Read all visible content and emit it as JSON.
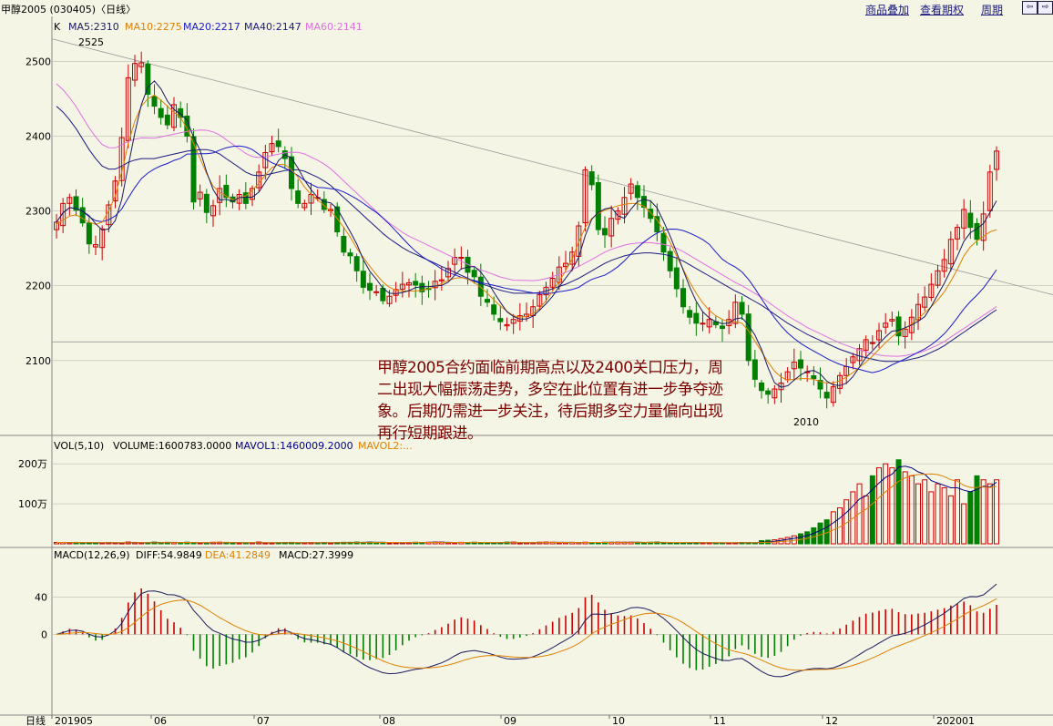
{
  "header": {
    "title": "甲醇2005 (030405)〈日线〉",
    "links": [
      "商品叠加",
      "查看期权",
      "周期"
    ],
    "nav_prev": "⇦",
    "nav_next": "⇨"
  },
  "colors": {
    "bg": "#f5f5e6",
    "grid": "#bdbdb0",
    "up": "#cc0000",
    "down": "#008000",
    "ma5": "#1a1a60",
    "ma10": "#e08000",
    "ma20": "#1a1acc",
    "ma40": "#1a1a80",
    "ma60": "#e070e0",
    "annotation": "#7a0000"
  },
  "chart_data": [
    {
      "type": "candlestick",
      "panel": "price",
      "legend": {
        "k": "K",
        "ma5": "MA5:2310",
        "ma10": "MA10:2275",
        "ma20": "MA20:2217",
        "ma40": "MA40:2147",
        "ma60": "MA60:2141"
      },
      "y_ticks": [
        "2500",
        "2400",
        "2300",
        "2200",
        "2100"
      ],
      "ylim": [
        2000,
        2560
      ],
      "annotations": {
        "high_label": "2525",
        "low_label": "2010"
      },
      "close_series": [
        2285,
        2310,
        2318,
        2301,
        2284,
        2256,
        2255,
        2276,
        2308,
        2340,
        2398,
        2478,
        2497,
        2498,
        2456,
        2440,
        2425,
        2415,
        2442,
        2425,
        2400,
        2312,
        2325,
        2298,
        2307,
        2330,
        2318,
        2312,
        2322,
        2310,
        2330,
        2352,
        2378,
        2390,
        2386,
        2370,
        2330,
        2310,
        2310,
        2322,
        2318,
        2302,
        2302,
        2272,
        2245,
        2240,
        2220,
        2198,
        2194,
        2192,
        2180,
        2186,
        2195,
        2202,
        2204,
        2201,
        2192,
        2195,
        2206,
        2208,
        2223,
        2238,
        2238,
        2218,
        2212,
        2186,
        2178,
        2162,
        2152,
        2148,
        2155,
        2160,
        2162,
        2172,
        2188,
        2198,
        2210,
        2225,
        2230,
        2245,
        2280,
        2355,
        2335,
        2275,
        2268,
        2290,
        2300,
        2318,
        2336,
        2318,
        2305,
        2290,
        2272,
        2245,
        2220,
        2196,
        2172,
        2158,
        2150,
        2150,
        2155,
        2148,
        2143,
        2155,
        2178,
        2162,
        2100,
        2075,
        2060,
        2055,
        2062,
        2070,
        2085,
        2098,
        2090,
        2085,
        2076,
        2062,
        2050,
        2065,
        2080,
        2092,
        2105,
        2116,
        2128,
        2124,
        2140,
        2150,
        2155,
        2133,
        2142,
        2158,
        2175,
        2185,
        2202,
        2220,
        2235,
        2262,
        2278,
        2302,
        2278,
        2262,
        2296,
        2352,
        2380
      ],
      "ma10_series": [
        2282,
        2288,
        2293,
        2295,
        2290,
        2285,
        2282,
        2285,
        2300,
        2320,
        2352,
        2390,
        2420,
        2440,
        2450,
        2455,
        2448,
        2440,
        2432,
        2425,
        2410,
        2390,
        2370,
        2350,
        2333,
        2325,
        2320,
        2315,
        2317,
        2320,
        2328,
        2337,
        2348,
        2358,
        2362,
        2362,
        2355,
        2345,
        2332,
        2322,
        2315,
        2307,
        2300,
        2290,
        2278,
        2265,
        2250,
        2238,
        2226,
        2215,
        2205,
        2198,
        2194,
        2193,
        2193,
        2193,
        2194,
        2196,
        2199,
        2203,
        2207,
        2210,
        2211,
        2209,
        2204,
        2198,
        2190,
        2181,
        2173,
        2166,
        2160,
        2158,
        2159,
        2163,
        2170,
        2180,
        2193,
        2206,
        2220,
        2236,
        2258,
        2278,
        2290,
        2297,
        2301,
        2304,
        2307,
        2309,
        2310,
        2310,
        2306,
        2298,
        2288,
        2274,
        2258,
        2240,
        2222,
        2205,
        2190,
        2177,
        2167,
        2160,
        2155,
        2152,
        2152,
        2150,
        2140,
        2126,
        2112,
        2098,
        2086,
        2078,
        2074,
        2075,
        2076,
        2076,
        2075,
        2072,
        2070,
        2070,
        2073,
        2078,
        2084,
        2091,
        2098,
        2106,
        2115,
        2124,
        2132,
        2138,
        2143,
        2149,
        2156,
        2164,
        2172,
        2181,
        2192,
        2206,
        2222,
        2240,
        2252,
        2260,
        2266,
        2272,
        2275
      ],
      "ma40_series": [
        2440,
        2432,
        2422,
        2410,
        2396,
        2382,
        2370,
        2360,
        2356,
        2356,
        2360,
        2365,
        2368,
        2370,
        2370,
        2370,
        2372,
        2374,
        2376,
        2378,
        2380,
        2381,
        2382,
        2382,
        2380,
        2376,
        2370,
        2364,
        2358,
        2352,
        2348,
        2347,
        2348,
        2350,
        2352,
        2354,
        2355,
        2355,
        2353,
        2349,
        2345,
        2340,
        2334,
        2326,
        2318,
        2310,
        2302,
        2294,
        2286,
        2278,
        2270,
        2263,
        2257,
        2251,
        2246,
        2242,
        2238,
        2234,
        2230,
        2226,
        2222,
        2218,
        2214,
        2210,
        2206,
        2203,
        2200,
        2197,
        2194,
        2192,
        2190,
        2190,
        2190,
        2190,
        2191,
        2193,
        2196,
        2199,
        2202,
        2206,
        2210,
        2215,
        2220,
        2225,
        2230,
        2234,
        2237,
        2240,
        2242,
        2243,
        2244,
        2244,
        2243,
        2242,
        2240,
        2237,
        2233,
        2228,
        2223,
        2218,
        2213,
        2208,
        2203,
        2198,
        2193,
        2189,
        2184,
        2179,
        2174,
        2168,
        2162,
        2156,
        2150,
        2145,
        2140,
        2135,
        2131,
        2127,
        2123,
        2119,
        2115,
        2112,
        2109,
        2106,
        2104,
        2102,
        2100,
        2099,
        2099,
        2099,
        2100,
        2102,
        2104,
        2107,
        2111,
        2115,
        2120,
        2126,
        2132,
        2138,
        2144,
        2150,
        2156,
        2162,
        2168
      ]
    },
    {
      "type": "bar",
      "panel": "volume",
      "legend": {
        "vol": "VOL(5,10)",
        "volume": "VOLUME:1600783.0000",
        "mavol1": "MAVOL1:1460009.2000",
        "mavol2": "MAVOL2:..."
      },
      "y_ticks": [
        "200万",
        "100万"
      ],
      "ylim": [
        0,
        2300000
      ],
      "late_values": [
        80000,
        90000,
        100000,
        130000,
        160000,
        200000,
        250000,
        300000,
        400000,
        520000,
        600000,
        800000,
        900000,
        1100000,
        1300000,
        1500000,
        1200000,
        1700000,
        1900000,
        2000000,
        1900000,
        2100000,
        1800000,
        1700000,
        1500000,
        1600000,
        1300000,
        1500000,
        1400000,
        1200000,
        1600000,
        1000000,
        1300000,
        1700000,
        1600000,
        1500000,
        1600000
      ]
    },
    {
      "type": "bar",
      "panel": "macd",
      "legend": {
        "macd": "MACD(12,26,9)",
        "diff": "DIFF:54.9849",
        "dea": "DEA:41.2849",
        "macd_val": "MACD:27.3999"
      },
      "y_ticks": [
        "40",
        "0"
      ],
      "ylim": [
        -85,
        75
      ]
    }
  ],
  "x_labels": [
    "日线",
    "201905",
    "06",
    "07",
    "08",
    "09",
    "10",
    "11",
    "12",
    "202001"
  ],
  "annotation_text": "甲醇2005合约面临前期高点以及2400关口压力，周二出现大幅振荡走势，多空在此位置有进一步争夺迹象。后期仍需进一步关注，待后期多空力量偏向出现再行短期跟进。"
}
